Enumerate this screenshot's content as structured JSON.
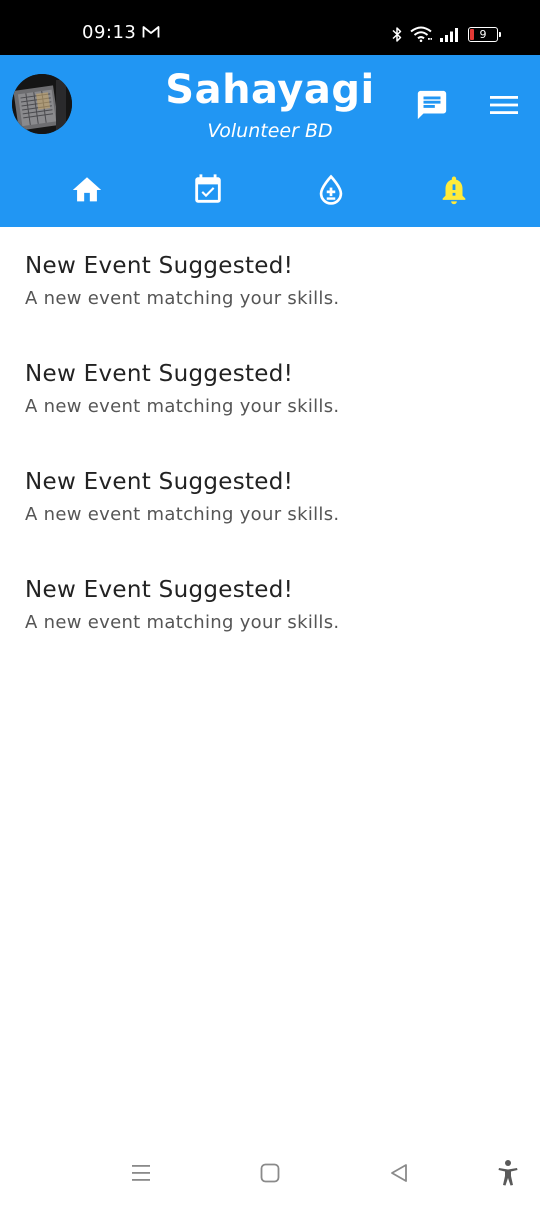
{
  "status_bar": {
    "time": "09:13",
    "battery_level": "9",
    "icons": [
      "mail-icon",
      "bluetooth-icon",
      "wifi-icon",
      "signal-icon",
      "battery-icon"
    ]
  },
  "header": {
    "title": "Sahayagi",
    "subtitle": "Volunteer BD",
    "background_color": "#2196f3",
    "actions": [
      "chat-icon",
      "hamburger-menu-icon"
    ]
  },
  "nav_tabs": [
    {
      "icon": "home-icon"
    },
    {
      "icon": "calendar-check-icon"
    },
    {
      "icon": "blood-drop-plus-icon"
    },
    {
      "icon": "bell-alert-icon",
      "active_color": "#ffeb3b"
    }
  ],
  "notifications": [
    {
      "title": "New Event Suggested!",
      "body": "A new event matching your skills."
    },
    {
      "title": "New Event Suggested!",
      "body": "A new event matching your skills."
    },
    {
      "title": "New Event Suggested!",
      "body": "A new event matching your skills."
    },
    {
      "title": "New Event Suggested!",
      "body": "A new event matching your skills."
    }
  ],
  "system_nav": [
    "recents-icon",
    "home-square-icon",
    "back-triangle-icon",
    "accessibility-icon"
  ]
}
